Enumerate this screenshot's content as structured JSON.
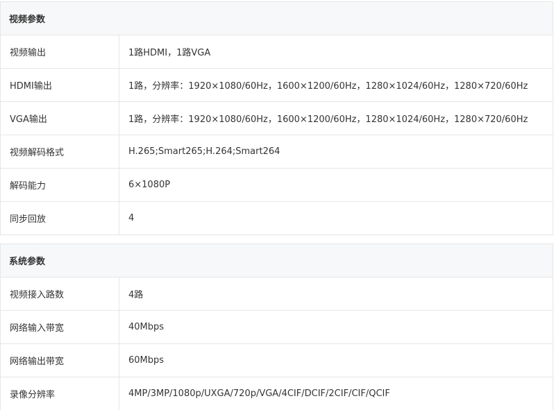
{
  "sections": [
    {
      "title": "视频参数",
      "rows": [
        {
          "label": "视频输出",
          "value": "1路HDMI，1路VGA"
        },
        {
          "label": "HDMI输出",
          "value": "1路，分辨率：1920×1080/60Hz，1600×1200/60Hz，1280×1024/60Hz，1280×720/60Hz"
        },
        {
          "label": "VGA输出",
          "value": "1路，分辨率：1920×1080/60Hz，1600×1200/60Hz，1280×1024/60Hz，1280×720/60Hz"
        },
        {
          "label": "视频解码格式",
          "value": "H.265;Smart265;H.264;Smart264"
        },
        {
          "label": "解码能力",
          "value": "6×1080P"
        },
        {
          "label": "同步回放",
          "value": "4"
        }
      ]
    },
    {
      "title": "系统参数",
      "rows": [
        {
          "label": "视频接入路数",
          "value": "4路"
        },
        {
          "label": "网络输入带宽",
          "value": "40Mbps"
        },
        {
          "label": "网络输出带宽",
          "value": "60Mbps"
        },
        {
          "label": "录像分辨率",
          "value": "4MP/3MP/1080p/UXGA/720p/VGA/4CIF/DCIF/2CIF/CIF/QCIF"
        }
      ]
    }
  ]
}
